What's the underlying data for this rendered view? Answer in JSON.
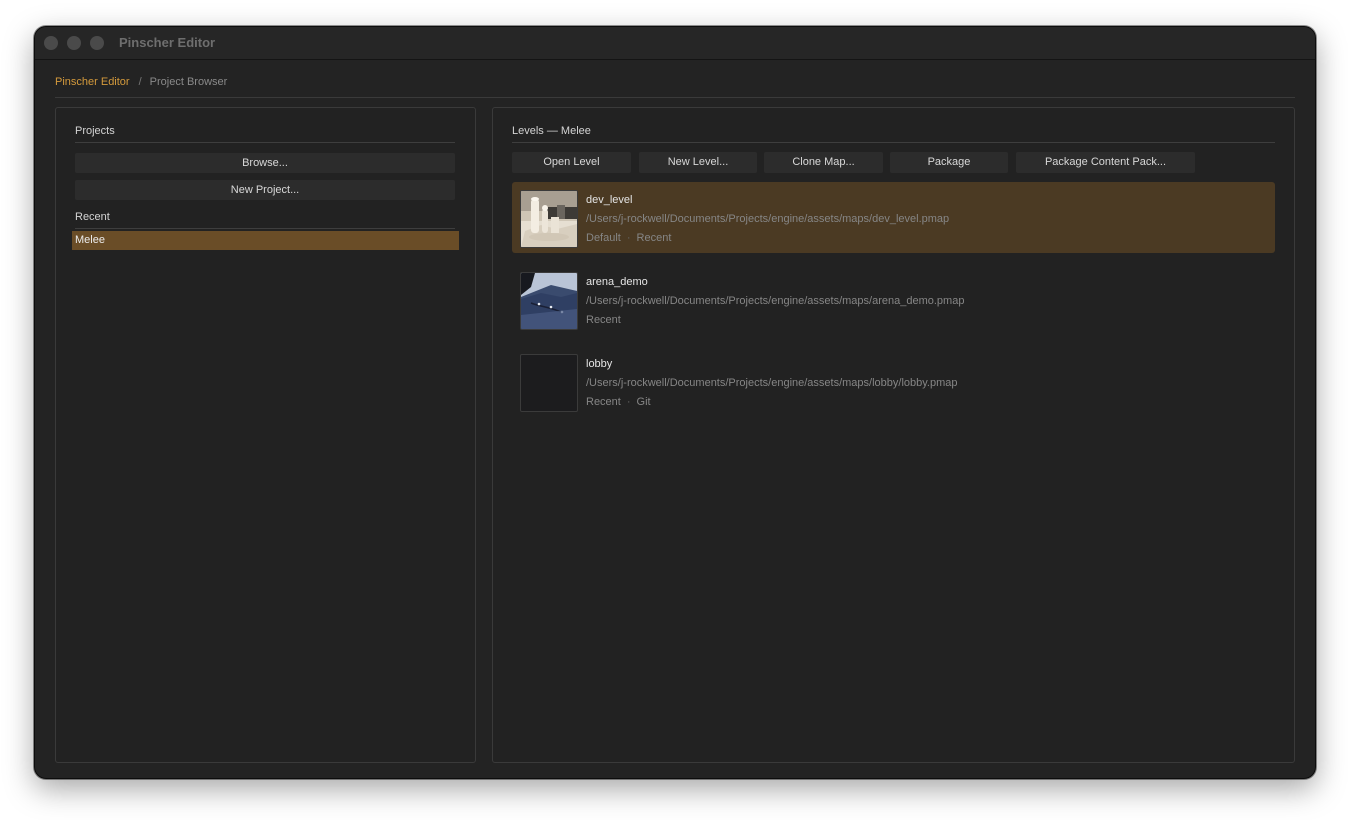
{
  "window": {
    "title": "Pinscher Editor"
  },
  "breadcrumb": {
    "app": "Pinscher Editor",
    "separator": "/",
    "current": "Project Browser"
  },
  "projects_panel": {
    "title": "Projects",
    "browse_label": "Browse...",
    "new_project_label": "New Project...",
    "recent_title": "Recent",
    "recent_items": [
      {
        "label": "Melee",
        "selected": true
      }
    ]
  },
  "levels_panel": {
    "title": "Levels — Melee",
    "toolbar": {
      "open_level": "Open Level",
      "new_level": "New Level...",
      "clone_map": "Clone Map...",
      "package": "Package",
      "package_content_pack": "Package Content Pack..."
    },
    "levels": [
      {
        "name": "dev_level",
        "path": "/Users/j-rockwell/Documents/Projects/engine/assets/maps/dev_level.pmap",
        "tags": [
          "Default",
          "Recent"
        ],
        "selected": true,
        "thumbnail": "white-geometry-scene"
      },
      {
        "name": "arena_demo",
        "path": "/Users/j-rockwell/Documents/Projects/engine/assets/maps/arena_demo.pmap",
        "tags": [
          "Recent"
        ],
        "selected": false,
        "thumbnail": "blue-landscape-scene"
      },
      {
        "name": "lobby",
        "path": "/Users/j-rockwell/Documents/Projects/engine/assets/maps/lobby/lobby.pmap",
        "tags": [
          "Recent",
          "Git"
        ],
        "selected": false,
        "thumbnail": "empty-dark"
      }
    ],
    "tag_separator": "·"
  },
  "colors": {
    "accent": "#d49a3c",
    "selection": "#6a4d27",
    "row_selection": "#4b3a23",
    "window_bg": "#232323"
  }
}
